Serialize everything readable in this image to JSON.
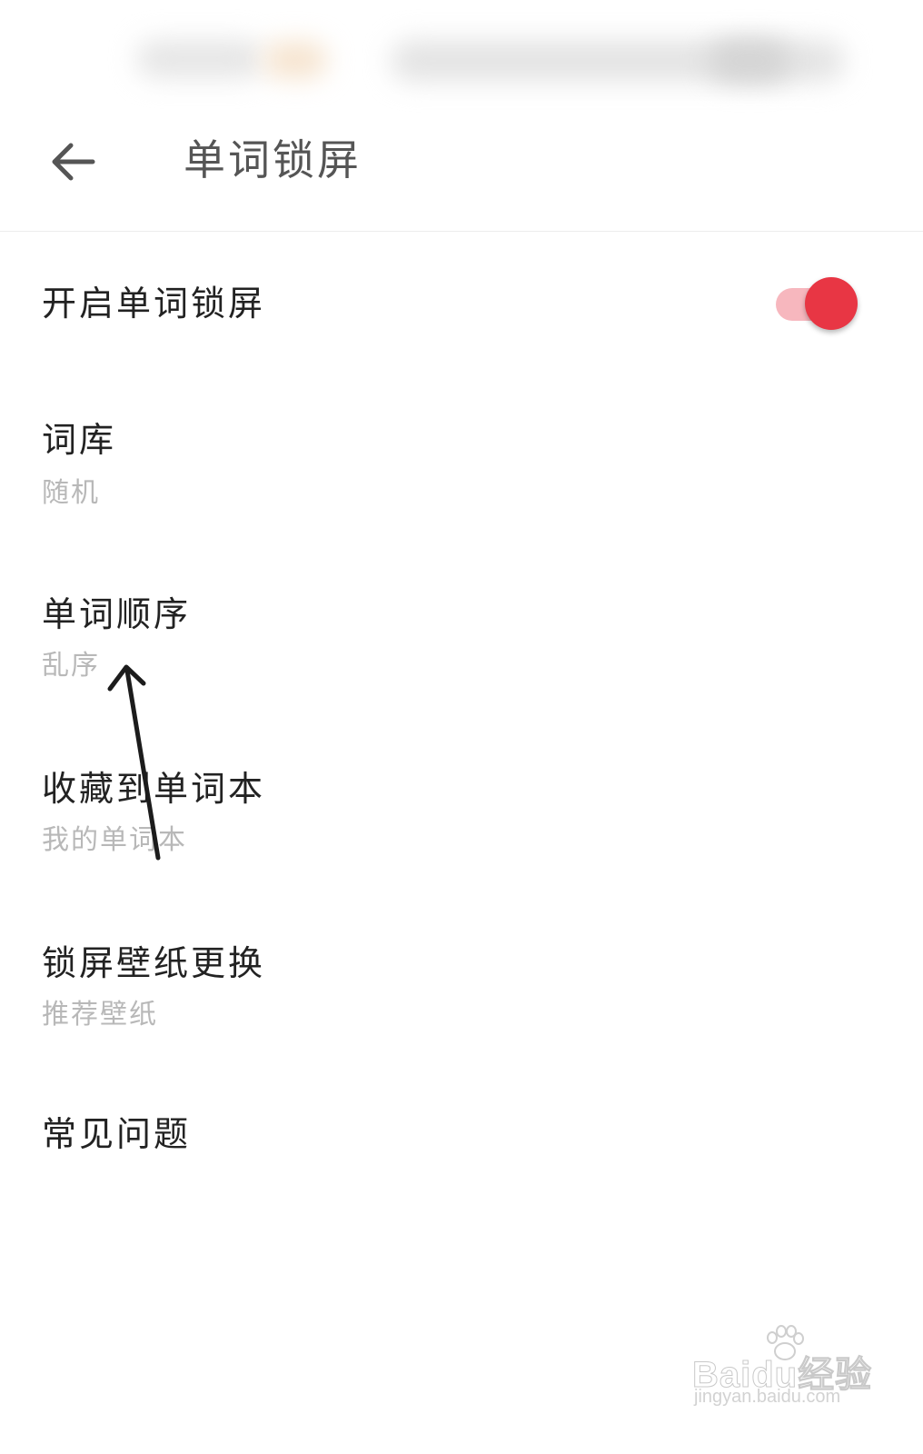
{
  "header": {
    "title": "单词锁屏"
  },
  "settings": [
    {
      "title": "开启单词锁屏",
      "subtitle": "",
      "toggle_on": true
    },
    {
      "title": "词库",
      "subtitle": "随机"
    },
    {
      "title": "单词顺序",
      "subtitle": "乱序"
    },
    {
      "title": "收藏到单词本",
      "subtitle": "我的单词本"
    },
    {
      "title": "锁屏壁纸更换",
      "subtitle": "推荐壁纸"
    },
    {
      "title": "常见问题",
      "subtitle": ""
    }
  ],
  "colors": {
    "accent": "#e83644",
    "toggle_track": "#f7b7be",
    "title_text": "#222222",
    "subtitle_text": "#b8b8b8"
  },
  "icons": {
    "back": "arrow-left-icon",
    "annotation": "annotation-arrow-icon"
  },
  "watermark": {
    "brand": "Baidu经验",
    "url": "jingyan.baidu.com"
  }
}
